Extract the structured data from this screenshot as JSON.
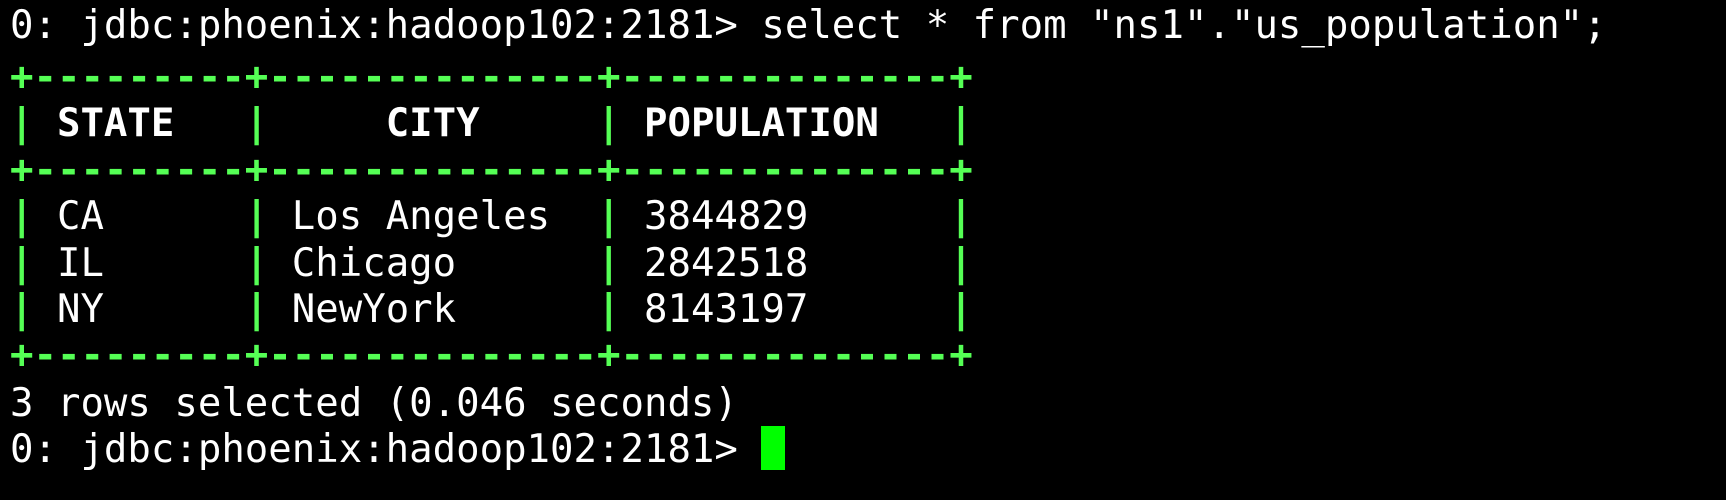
{
  "terminal": {
    "prompt": "0: jdbc:phoenix:hadoop102:2181> ",
    "command": "select * from \"ns1\".\"us_population\";",
    "table": {
      "border": "+---------+--------------+--------------+",
      "headers": [
        "STATE",
        "CITY",
        "POPULATION"
      ],
      "rows": [
        [
          "CA",
          "Los Angeles",
          "3844829"
        ],
        [
          "IL",
          "Chicago",
          "2842518"
        ],
        [
          "NY",
          "NewYork",
          "8143197"
        ]
      ]
    },
    "summary": "3 rows selected (0.046 seconds)",
    "prompt2": "0: jdbc:phoenix:hadoop102:2181> "
  },
  "colors": {
    "background": "#000000",
    "text": "#ffffff",
    "table_border": "#55ff55",
    "cursor": "#00ff00"
  }
}
